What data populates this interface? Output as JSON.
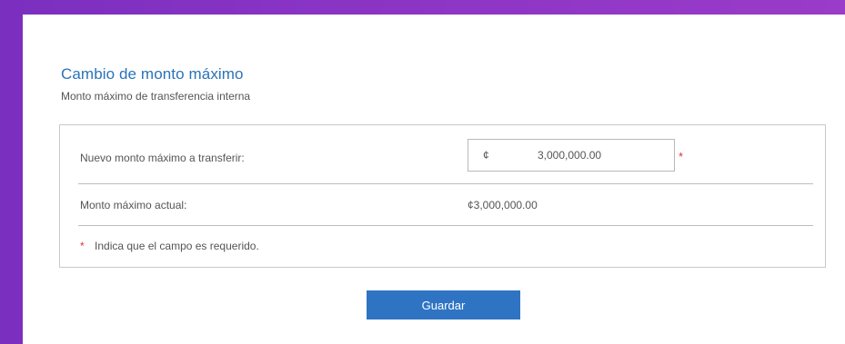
{
  "form": {
    "title": "Cambio de monto máximo",
    "subtitle": "Monto máximo de transferencia interna",
    "new_amount_label": "Nuevo monto máximo a transferir:",
    "currency_symbol": "¢",
    "new_amount_value": "3,000,000.00",
    "required_marker": "*",
    "current_amount_label": "Monto máximo actual:",
    "current_amount_value": "¢3,000,000.00",
    "required_note": "Indica que el campo es requerido.",
    "save_label": "Guardar"
  },
  "colors": {
    "title": "#2a73b8",
    "button": "#2f74c3",
    "required": "#e0303a",
    "background": "#8a34c4"
  }
}
